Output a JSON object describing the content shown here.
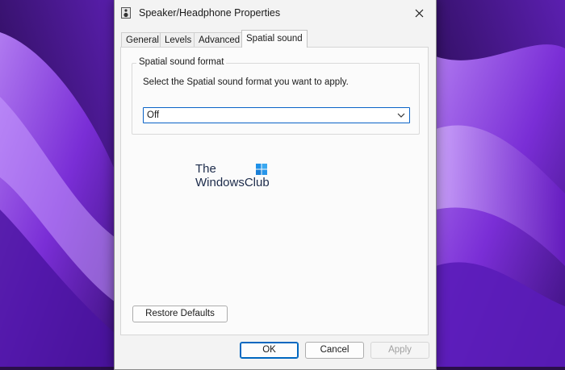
{
  "window": {
    "title": "Speaker/Headphone Properties",
    "close_icon": "close-icon",
    "title_icon": "speaker-icon"
  },
  "tabs": [
    {
      "label": "General",
      "active": false
    },
    {
      "label": "Levels",
      "active": false
    },
    {
      "label": "Advanced",
      "active": false
    },
    {
      "label": "Spatial sound",
      "active": true
    }
  ],
  "spatial": {
    "group_title": "Spatial sound format",
    "description": "Select the Spatial sound format you want to apply.",
    "format_selected": "Off",
    "dropdown_icon": "chevron-down-icon"
  },
  "watermark": {
    "line1": "The",
    "line2": "WindowsClub"
  },
  "buttons": {
    "restore_defaults": "Restore Defaults",
    "ok": "OK",
    "cancel": "Cancel",
    "apply": "Apply"
  },
  "colors": {
    "accent": "#0067c0",
    "wallpaper_primary": "#7a2ed6",
    "wallpaper_dark": "#2a0f4a"
  }
}
